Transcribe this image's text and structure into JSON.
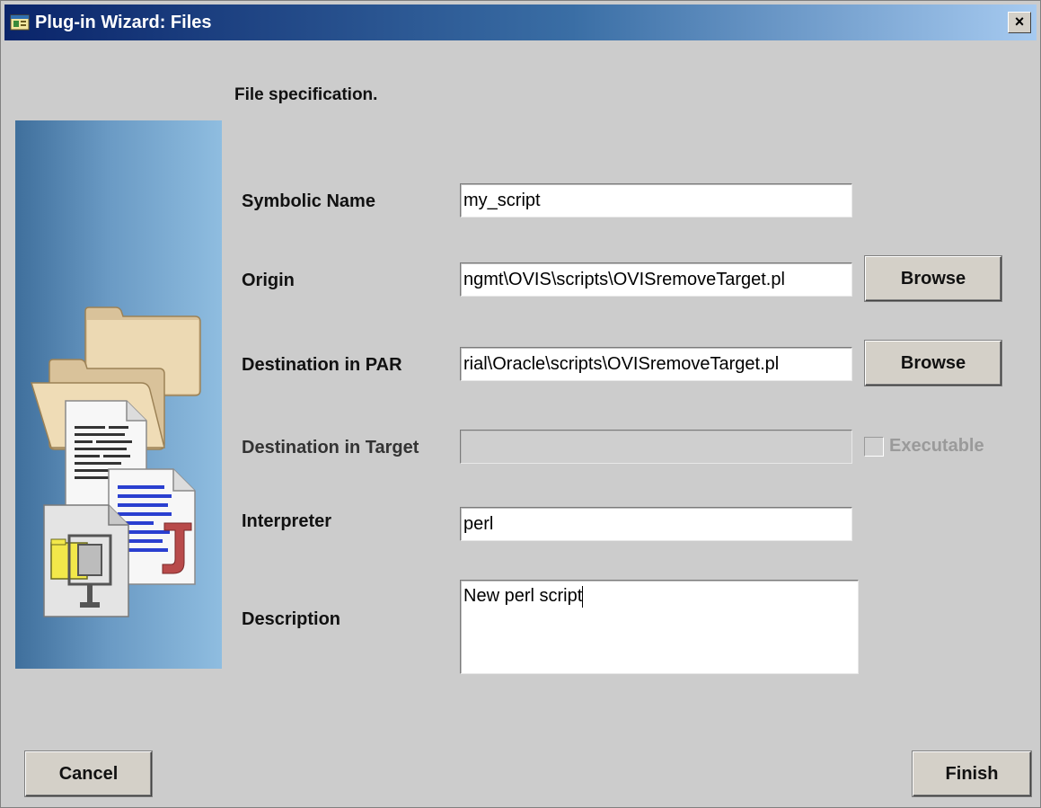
{
  "window": {
    "title": "Plug-in Wizard: Files",
    "close_label": "×"
  },
  "heading": "File specification.",
  "form": {
    "symbolic_name": {
      "label": "Symbolic Name",
      "value": "my_script"
    },
    "origin": {
      "label": "Origin",
      "value": "ngmt\\OVIS\\scripts\\OVISremoveTarget.pl",
      "button": "Browse"
    },
    "destination_par": {
      "label": "Destination in PAR",
      "value": "rial\\Oracle\\scripts\\OVISremoveTarget.pl",
      "button": "Browse"
    },
    "destination_target": {
      "label": "Destination in Target",
      "value": "",
      "disabled": true,
      "checkbox_label": "Executable",
      "checked": false
    },
    "interpreter": {
      "label": "Interpreter",
      "value": "perl"
    },
    "description": {
      "label": "Description",
      "value": "New perl script"
    }
  },
  "footer": {
    "cancel_label": "Cancel",
    "finish_label": "Finish"
  },
  "icons": {
    "title_icon": "wizard-window-icon",
    "side_art": [
      "folder-icon",
      "folder-icon",
      "text-document-icon",
      "java-document-icon",
      "archive-document-icon"
    ]
  },
  "colors": {
    "titlebar_start": "#0a246a",
    "titlebar_end": "#a6caf0",
    "dialog_bg": "#cccccc",
    "side_panel": "#6a9ac4"
  }
}
